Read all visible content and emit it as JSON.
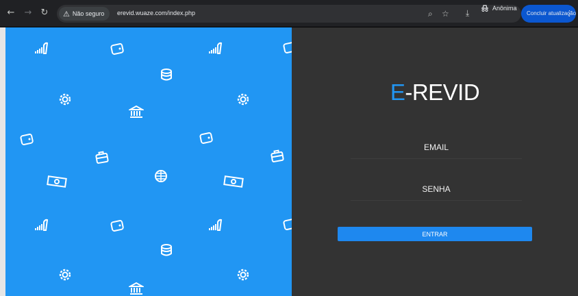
{
  "browser": {
    "back_icon": "arrow-left-icon",
    "forward_icon": "arrow-right-icon",
    "reload_icon": "reload-icon",
    "security_label": "Não seguro",
    "url": "erevid.wuaze.com/index.php",
    "zoom_icon": "magnifier-icon",
    "bookmark_icon": "star-icon",
    "download_icon": "download-icon",
    "incognito_label": "Anônima",
    "update_label": "Concluir atualização"
  },
  "login": {
    "brand_first": "E",
    "brand_rest": "-REVID",
    "email_placeholder": "EMAIL",
    "senha_placeholder": "SENHA",
    "submit_label": "ENTRAR"
  },
  "colors": {
    "accent": "#2196f3",
    "panel_dark": "#333333",
    "button": "#1e88ef"
  }
}
